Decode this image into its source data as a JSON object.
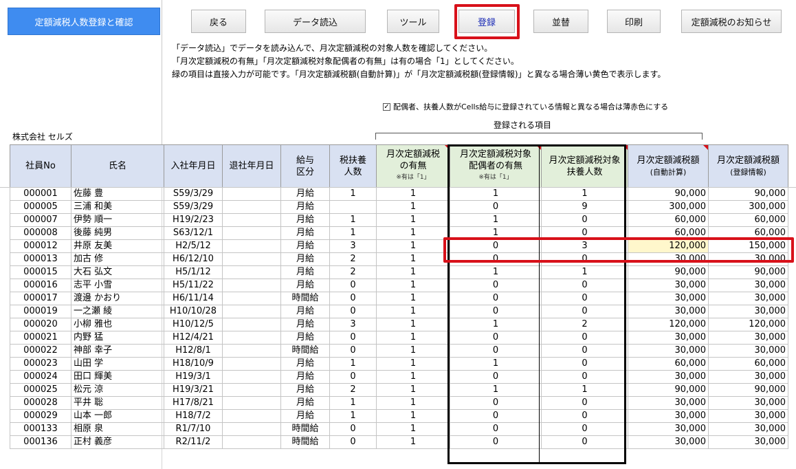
{
  "title_button": "定額減税人数登録と確認",
  "toolbar": {
    "back": "戻る",
    "data_load": "データ読込",
    "tools": "ツール",
    "register": "登録",
    "sort": "並替",
    "print": "印刷",
    "notice": "定額減税のお知らせ"
  },
  "instructions": [
    "「データ読込」でデータを読み込んで、月次定額減税の対象人数を確認してください。",
    "「月次定額減税の有無」「月次定額減税対象配偶者の有無」は有の場合「1」としてください。",
    "緑の項目は直接入力が可能です。「月次定額減税額(自動計算)」が「月次定額減税額(登録情報)」と異なる場合薄い黄色で表示します。"
  ],
  "checkbox": {
    "checked": true,
    "label": "配偶者、扶養人数がCells給与に登録されている情報と異なる場合は薄赤色にする"
  },
  "registered_items_label": "登録される項目",
  "company": "株式会社 セルズ",
  "headers": {
    "emp_no": "社員No",
    "name": "氏名",
    "join_date": "入社年月日",
    "leave_date": "退社年月日",
    "pay_type_1": "給与",
    "pay_type_2": "区分",
    "dependents_1": "税扶養",
    "dependents_2": "人数",
    "tax_flag_1": "月次定額減税",
    "tax_flag_2": "の有無",
    "tax_flag_note": "※有は「1」",
    "spouse_flag_1": "月次定額減税対象",
    "spouse_flag_2": "配偶者の有無",
    "spouse_flag_note": "※有は「1」",
    "target_dep_1": "月次定額減税対象",
    "target_dep_2": "扶養人数",
    "amount_auto_1": "月次定額減税額",
    "amount_auto_2": "(自動計算)",
    "amount_reg_1": "月次定額減税額",
    "amount_reg_2": "(登録情報)"
  },
  "rows": [
    {
      "no": "000001",
      "name": "佐藤 豊",
      "join": "S59/3/29",
      "leave": "",
      "pay": "月給",
      "dep": "1",
      "tax": "1",
      "spouse": "1",
      "tdep": "1",
      "auto": "90,000",
      "reg": "90,000"
    },
    {
      "no": "000005",
      "name": "三浦 和美",
      "join": "S59/3/29",
      "leave": "",
      "pay": "月給",
      "dep": "",
      "tax": "1",
      "spouse": "0",
      "tdep": "9",
      "auto": "300,000",
      "reg": "300,000"
    },
    {
      "no": "000007",
      "name": "伊勢 順一",
      "join": "H19/2/23",
      "leave": "",
      "pay": "月給",
      "dep": "1",
      "tax": "1",
      "spouse": "1",
      "tdep": "0",
      "auto": "60,000",
      "reg": "60,000"
    },
    {
      "no": "000008",
      "name": "後藤 純男",
      "join": "S63/12/1",
      "leave": "",
      "pay": "月給",
      "dep": "1",
      "tax": "1",
      "spouse": "1",
      "tdep": "0",
      "auto": "60,000",
      "reg": "60,000"
    },
    {
      "no": "000012",
      "name": "井原 友美",
      "join": "H2/5/12",
      "leave": "",
      "pay": "月給",
      "dep": "3",
      "tax": "1",
      "spouse": "0",
      "tdep": "3",
      "auto": "120,000",
      "reg": "150,000",
      "highlight": true
    },
    {
      "no": "000013",
      "name": "加古 修",
      "join": "H6/12/10",
      "leave": "",
      "pay": "月給",
      "dep": "2",
      "tax": "1",
      "spouse": "0",
      "tdep": "0",
      "auto": "30,000",
      "reg": "30,000"
    },
    {
      "no": "000015",
      "name": "大石 弘文",
      "join": "H5/1/12",
      "leave": "",
      "pay": "月給",
      "dep": "2",
      "tax": "1",
      "spouse": "1",
      "tdep": "1",
      "auto": "90,000",
      "reg": "90,000"
    },
    {
      "no": "000016",
      "name": "志平 小雪",
      "join": "H5/11/22",
      "leave": "",
      "pay": "月給",
      "dep": "0",
      "tax": "1",
      "spouse": "0",
      "tdep": "0",
      "auto": "30,000",
      "reg": "30,000"
    },
    {
      "no": "000017",
      "name": "渡邊 かおり",
      "join": "H6/11/14",
      "leave": "",
      "pay": "時間給",
      "dep": "0",
      "tax": "1",
      "spouse": "0",
      "tdep": "0",
      "auto": "30,000",
      "reg": "30,000"
    },
    {
      "no": "000019",
      "name": "一之瀬 綾",
      "join": "H10/10/28",
      "leave": "",
      "pay": "月給",
      "dep": "0",
      "tax": "1",
      "spouse": "0",
      "tdep": "0",
      "auto": "30,000",
      "reg": "30,000"
    },
    {
      "no": "000020",
      "name": "小柳 雅也",
      "join": "H10/12/5",
      "leave": "",
      "pay": "月給",
      "dep": "3",
      "tax": "1",
      "spouse": "1",
      "tdep": "2",
      "auto": "120,000",
      "reg": "120,000"
    },
    {
      "no": "000021",
      "name": "内野 猛",
      "join": "H12/4/21",
      "leave": "",
      "pay": "月給",
      "dep": "0",
      "tax": "1",
      "spouse": "0",
      "tdep": "0",
      "auto": "30,000",
      "reg": "30,000"
    },
    {
      "no": "000022",
      "name": "神部 幸子",
      "join": "H12/8/1",
      "leave": "",
      "pay": "時間給",
      "dep": "0",
      "tax": "1",
      "spouse": "0",
      "tdep": "0",
      "auto": "30,000",
      "reg": "30,000"
    },
    {
      "no": "000023",
      "name": "山田 学",
      "join": "H18/10/9",
      "leave": "",
      "pay": "月給",
      "dep": "1",
      "tax": "1",
      "spouse": "1",
      "tdep": "0",
      "auto": "60,000",
      "reg": "60,000"
    },
    {
      "no": "000024",
      "name": "田口 輝美",
      "join": "H19/3/1",
      "leave": "",
      "pay": "月給",
      "dep": "0",
      "tax": "1",
      "spouse": "0",
      "tdep": "0",
      "auto": "30,000",
      "reg": "30,000"
    },
    {
      "no": "000025",
      "name": "松元 涼",
      "join": "H19/3/21",
      "leave": "",
      "pay": "月給",
      "dep": "2",
      "tax": "1",
      "spouse": "1",
      "tdep": "1",
      "auto": "90,000",
      "reg": "90,000"
    },
    {
      "no": "000028",
      "name": "平井 聡",
      "join": "H17/8/21",
      "leave": "",
      "pay": "月給",
      "dep": "1",
      "tax": "1",
      "spouse": "0",
      "tdep": "0",
      "auto": "30,000",
      "reg": "30,000"
    },
    {
      "no": "000029",
      "name": "山本 一郎",
      "join": "H18/7/2",
      "leave": "",
      "pay": "月給",
      "dep": "1",
      "tax": "1",
      "spouse": "0",
      "tdep": "0",
      "auto": "30,000",
      "reg": "30,000"
    },
    {
      "no": "000133",
      "name": "相原 泉",
      "join": "R1/7/10",
      "leave": "",
      "pay": "時間給",
      "dep": "0",
      "tax": "1",
      "spouse": "0",
      "tdep": "0",
      "auto": "30,000",
      "reg": "30,000"
    },
    {
      "no": "000136",
      "name": "正村 義彦",
      "join": "R2/11/2",
      "leave": "",
      "pay": "時間給",
      "dep": "0",
      "tax": "1",
      "spouse": "0",
      "tdep": "0",
      "auto": "30,000",
      "reg": "30,000"
    }
  ],
  "colors": {
    "title_bg": "#3f8cf0",
    "header_blue": "#d9e1f2",
    "header_green": "#e2efda",
    "highlight_red": "#d8111a",
    "diff_yellow": "#fff7cc"
  }
}
